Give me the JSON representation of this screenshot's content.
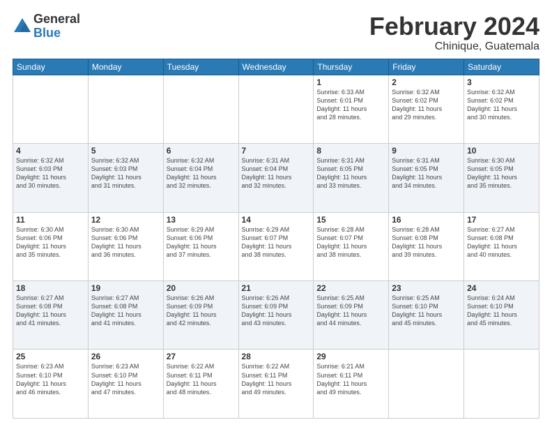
{
  "logo": {
    "general": "General",
    "blue": "Blue"
  },
  "title": "February 2024",
  "location": "Chinique, Guatemala",
  "days_of_week": [
    "Sunday",
    "Monday",
    "Tuesday",
    "Wednesday",
    "Thursday",
    "Friday",
    "Saturday"
  ],
  "weeks": [
    [
      {
        "day": "",
        "info": ""
      },
      {
        "day": "",
        "info": ""
      },
      {
        "day": "",
        "info": ""
      },
      {
        "day": "",
        "info": ""
      },
      {
        "day": "1",
        "info": "Sunrise: 6:33 AM\nSunset: 6:01 PM\nDaylight: 11 hours\nand 28 minutes."
      },
      {
        "day": "2",
        "info": "Sunrise: 6:32 AM\nSunset: 6:02 PM\nDaylight: 11 hours\nand 29 minutes."
      },
      {
        "day": "3",
        "info": "Sunrise: 6:32 AM\nSunset: 6:02 PM\nDaylight: 11 hours\nand 30 minutes."
      }
    ],
    [
      {
        "day": "4",
        "info": "Sunrise: 6:32 AM\nSunset: 6:03 PM\nDaylight: 11 hours\nand 30 minutes."
      },
      {
        "day": "5",
        "info": "Sunrise: 6:32 AM\nSunset: 6:03 PM\nDaylight: 11 hours\nand 31 minutes."
      },
      {
        "day": "6",
        "info": "Sunrise: 6:32 AM\nSunset: 6:04 PM\nDaylight: 11 hours\nand 32 minutes."
      },
      {
        "day": "7",
        "info": "Sunrise: 6:31 AM\nSunset: 6:04 PM\nDaylight: 11 hours\nand 32 minutes."
      },
      {
        "day": "8",
        "info": "Sunrise: 6:31 AM\nSunset: 6:05 PM\nDaylight: 11 hours\nand 33 minutes."
      },
      {
        "day": "9",
        "info": "Sunrise: 6:31 AM\nSunset: 6:05 PM\nDaylight: 11 hours\nand 34 minutes."
      },
      {
        "day": "10",
        "info": "Sunrise: 6:30 AM\nSunset: 6:05 PM\nDaylight: 11 hours\nand 35 minutes."
      }
    ],
    [
      {
        "day": "11",
        "info": "Sunrise: 6:30 AM\nSunset: 6:06 PM\nDaylight: 11 hours\nand 35 minutes."
      },
      {
        "day": "12",
        "info": "Sunrise: 6:30 AM\nSunset: 6:06 PM\nDaylight: 11 hours\nand 36 minutes."
      },
      {
        "day": "13",
        "info": "Sunrise: 6:29 AM\nSunset: 6:06 PM\nDaylight: 11 hours\nand 37 minutes."
      },
      {
        "day": "14",
        "info": "Sunrise: 6:29 AM\nSunset: 6:07 PM\nDaylight: 11 hours\nand 38 minutes."
      },
      {
        "day": "15",
        "info": "Sunrise: 6:28 AM\nSunset: 6:07 PM\nDaylight: 11 hours\nand 38 minutes."
      },
      {
        "day": "16",
        "info": "Sunrise: 6:28 AM\nSunset: 6:08 PM\nDaylight: 11 hours\nand 39 minutes."
      },
      {
        "day": "17",
        "info": "Sunrise: 6:27 AM\nSunset: 6:08 PM\nDaylight: 11 hours\nand 40 minutes."
      }
    ],
    [
      {
        "day": "18",
        "info": "Sunrise: 6:27 AM\nSunset: 6:08 PM\nDaylight: 11 hours\nand 41 minutes."
      },
      {
        "day": "19",
        "info": "Sunrise: 6:27 AM\nSunset: 6:08 PM\nDaylight: 11 hours\nand 41 minutes."
      },
      {
        "day": "20",
        "info": "Sunrise: 6:26 AM\nSunset: 6:09 PM\nDaylight: 11 hours\nand 42 minutes."
      },
      {
        "day": "21",
        "info": "Sunrise: 6:26 AM\nSunset: 6:09 PM\nDaylight: 11 hours\nand 43 minutes."
      },
      {
        "day": "22",
        "info": "Sunrise: 6:25 AM\nSunset: 6:09 PM\nDaylight: 11 hours\nand 44 minutes."
      },
      {
        "day": "23",
        "info": "Sunrise: 6:25 AM\nSunset: 6:10 PM\nDaylight: 11 hours\nand 45 minutes."
      },
      {
        "day": "24",
        "info": "Sunrise: 6:24 AM\nSunset: 6:10 PM\nDaylight: 11 hours\nand 45 minutes."
      }
    ],
    [
      {
        "day": "25",
        "info": "Sunrise: 6:23 AM\nSunset: 6:10 PM\nDaylight: 11 hours\nand 46 minutes."
      },
      {
        "day": "26",
        "info": "Sunrise: 6:23 AM\nSunset: 6:10 PM\nDaylight: 11 hours\nand 47 minutes."
      },
      {
        "day": "27",
        "info": "Sunrise: 6:22 AM\nSunset: 6:11 PM\nDaylight: 11 hours\nand 48 minutes."
      },
      {
        "day": "28",
        "info": "Sunrise: 6:22 AM\nSunset: 6:11 PM\nDaylight: 11 hours\nand 49 minutes."
      },
      {
        "day": "29",
        "info": "Sunrise: 6:21 AM\nSunset: 6:11 PM\nDaylight: 11 hours\nand 49 minutes."
      },
      {
        "day": "",
        "info": ""
      },
      {
        "day": "",
        "info": ""
      }
    ]
  ]
}
